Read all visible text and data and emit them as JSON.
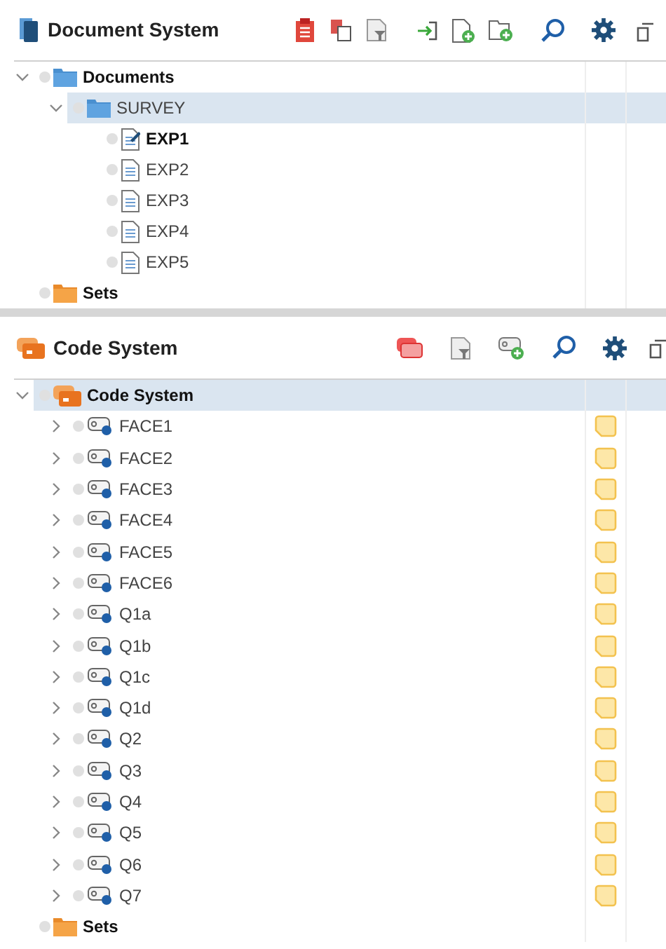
{
  "document_system": {
    "title": "Document System",
    "tree": [
      {
        "kind": "folder",
        "label": "Documents",
        "expanded": true,
        "selected": false,
        "children": [
          {
            "kind": "folder",
            "label": "SURVEY",
            "expanded": true,
            "selected": true,
            "children": [
              {
                "kind": "document",
                "label": "EXP1",
                "active": true,
                "selected": false
              },
              {
                "kind": "document",
                "label": "EXP2",
                "active": false,
                "selected": false
              },
              {
                "kind": "document",
                "label": "EXP3",
                "active": false,
                "selected": false
              },
              {
                "kind": "document",
                "label": "EXP4",
                "active": false,
                "selected": false
              },
              {
                "kind": "document",
                "label": "EXP5",
                "active": false,
                "selected": false
              }
            ]
          }
        ]
      },
      {
        "kind": "sets",
        "label": "Sets",
        "selected": false
      }
    ]
  },
  "code_system": {
    "title": "Code System",
    "tree": [
      {
        "kind": "code-system",
        "label": "Code System",
        "expanded": true,
        "selected": true,
        "children": [
          {
            "kind": "code",
            "label": "FACE1",
            "expanded": false,
            "selected": false,
            "memo": true
          },
          {
            "kind": "code",
            "label": "FACE2",
            "expanded": false,
            "selected": false,
            "memo": true
          },
          {
            "kind": "code",
            "label": "FACE3",
            "expanded": false,
            "selected": false,
            "memo": true
          },
          {
            "kind": "code",
            "label": "FACE4",
            "expanded": false,
            "selected": false,
            "memo": true
          },
          {
            "kind": "code",
            "label": "FACE5",
            "expanded": false,
            "selected": false,
            "memo": true
          },
          {
            "kind": "code",
            "label": "FACE6",
            "expanded": false,
            "selected": false,
            "memo": true
          },
          {
            "kind": "code",
            "label": "Q1a",
            "expanded": false,
            "selected": false,
            "memo": true
          },
          {
            "kind": "code",
            "label": "Q1b",
            "expanded": false,
            "selected": false,
            "memo": true
          },
          {
            "kind": "code",
            "label": "Q1c",
            "expanded": false,
            "selected": false,
            "memo": true
          },
          {
            "kind": "code",
            "label": "Q1d",
            "expanded": false,
            "selected": false,
            "memo": true
          },
          {
            "kind": "code",
            "label": "Q2",
            "expanded": false,
            "selected": false,
            "memo": true
          },
          {
            "kind": "code",
            "label": "Q3",
            "expanded": false,
            "selected": false,
            "memo": true
          },
          {
            "kind": "code",
            "label": "Q4",
            "expanded": false,
            "selected": false,
            "memo": true
          },
          {
            "kind": "code",
            "label": "Q5",
            "expanded": false,
            "selected": false,
            "memo": true
          },
          {
            "kind": "code",
            "label": "Q6",
            "expanded": false,
            "selected": false,
            "memo": true
          },
          {
            "kind": "code",
            "label": "Q7",
            "expanded": false,
            "selected": false,
            "memo": true
          }
        ]
      },
      {
        "kind": "sets",
        "label": "Sets",
        "selected": false
      }
    ]
  }
}
